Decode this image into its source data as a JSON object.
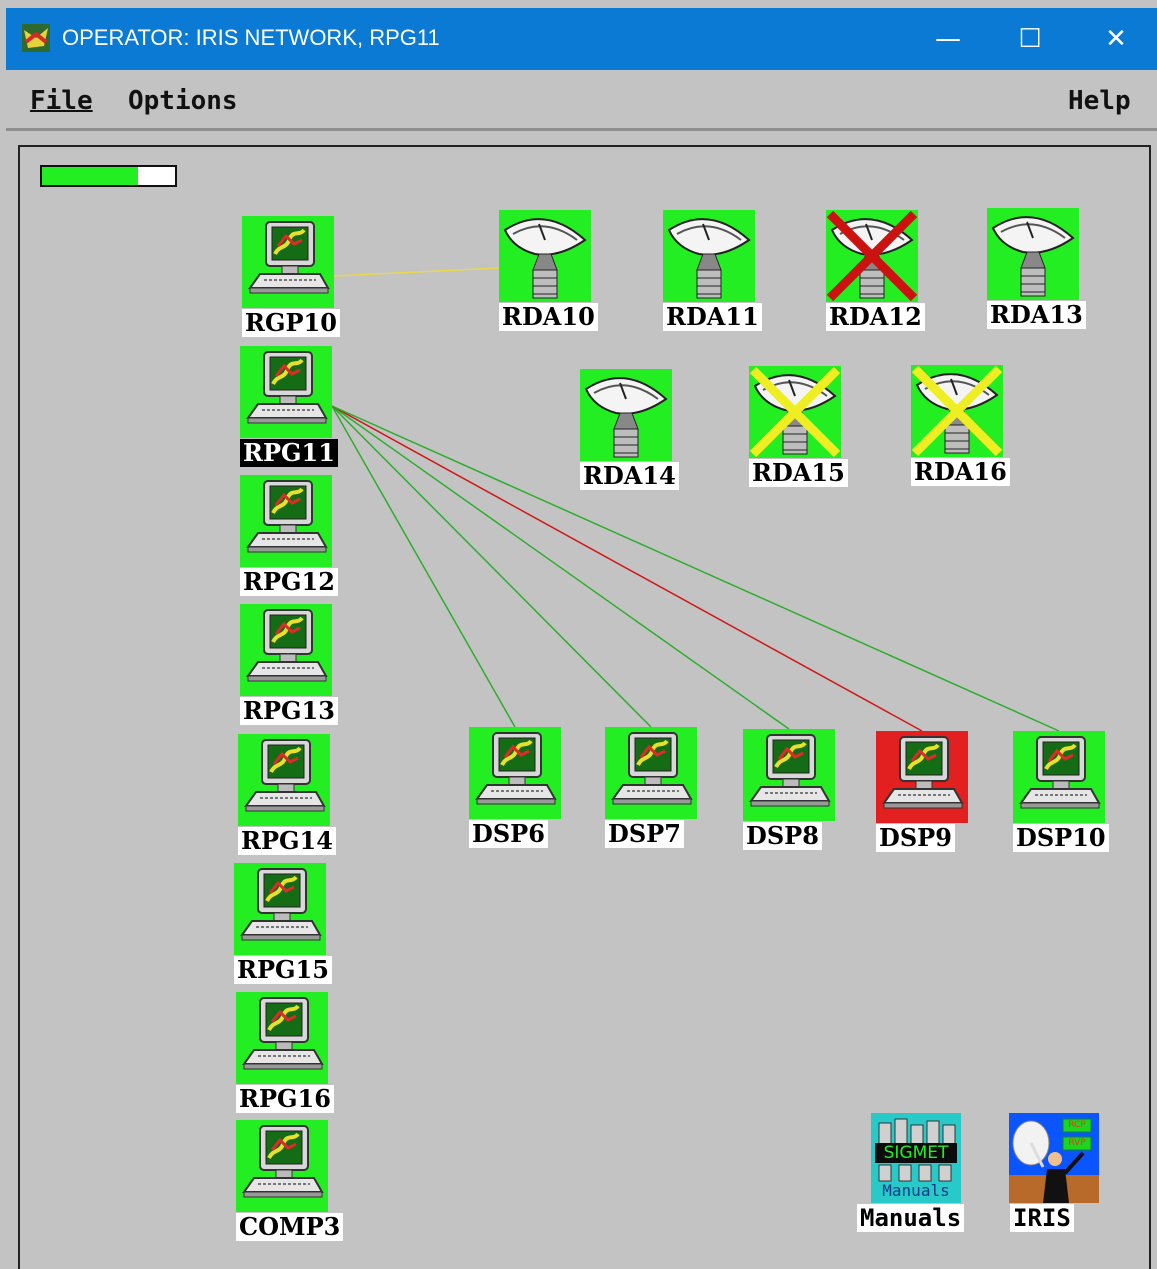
{
  "window": {
    "title": "OPERATOR: IRIS NETWORK, RPG11",
    "minimize_glyph": "—",
    "maximize_glyph": "☐",
    "close_glyph": "✕"
  },
  "menu": {
    "file": "File",
    "options": "Options",
    "help": "Help"
  },
  "status": {
    "progress_fraction": 0.72,
    "progress_color": "#22ee22"
  },
  "colors": {
    "ok": "#22ee22",
    "error": "#e32020",
    "warning_cross": "#eeee22",
    "failed_cross": "#cc1111",
    "link_ok": "#2dad2d",
    "link_error": "#d01818",
    "link_radar": "#e8d84a"
  },
  "rpg_nodes": [
    {
      "label": "RGP10",
      "icon": "workstation-icon",
      "status": "ok"
    },
    {
      "label": "RPG11",
      "icon": "workstation-icon",
      "status": "ok",
      "selected": true
    },
    {
      "label": "RPG12",
      "icon": "workstation-icon",
      "status": "ok"
    },
    {
      "label": "RPG13",
      "icon": "workstation-icon",
      "status": "ok"
    },
    {
      "label": "RPG14",
      "icon": "workstation-icon",
      "status": "ok"
    },
    {
      "label": "RPG15",
      "icon": "workstation-icon",
      "status": "ok"
    },
    {
      "label": "RPG16",
      "icon": "workstation-icon",
      "status": "ok"
    },
    {
      "label": "COMP3",
      "icon": "workstation-icon",
      "status": "ok"
    }
  ],
  "rda_nodes": [
    {
      "label": "RDA10",
      "icon": "radar-dish-icon",
      "status": "ok"
    },
    {
      "label": "RDA11",
      "icon": "radar-dish-icon",
      "status": "ok"
    },
    {
      "label": "RDA12",
      "icon": "radar-dish-icon",
      "status": "failed"
    },
    {
      "label": "RDA13",
      "icon": "radar-dish-icon",
      "status": "ok"
    },
    {
      "label": "RDA14",
      "icon": "radar-dish-icon",
      "status": "ok"
    },
    {
      "label": "RDA15",
      "icon": "radar-dish-icon",
      "status": "warning"
    },
    {
      "label": "RDA16",
      "icon": "radar-dish-icon",
      "status": "warning"
    }
  ],
  "dsp_nodes": [
    {
      "label": "DSP6",
      "icon": "workstation-icon",
      "status": "ok"
    },
    {
      "label": "DSP7",
      "icon": "workstation-icon",
      "status": "ok"
    },
    {
      "label": "DSP8",
      "icon": "workstation-icon",
      "status": "ok"
    },
    {
      "label": "DSP9",
      "icon": "workstation-icon",
      "status": "error"
    },
    {
      "label": "DSP10",
      "icon": "workstation-icon",
      "status": "ok"
    }
  ],
  "links": [
    {
      "from": "RGP10",
      "to": "RDA10",
      "status": "radar"
    },
    {
      "from": "RPG11",
      "to": "DSP6",
      "status": "ok"
    },
    {
      "from": "RPG11",
      "to": "DSP7",
      "status": "ok"
    },
    {
      "from": "RPG11",
      "to": "DSP8",
      "status": "ok"
    },
    {
      "from": "RPG11",
      "to": "DSP9",
      "status": "error"
    },
    {
      "from": "RPG11",
      "to": "DSP10",
      "status": "ok"
    }
  ],
  "tools": {
    "manuals": {
      "label": "Manuals",
      "icon_text": "SIGMET",
      "icon_subtext": "Manuals"
    },
    "iris": {
      "label": "IRIS",
      "icon_text_top": "RCP",
      "icon_text_bottom": "RVP"
    }
  }
}
